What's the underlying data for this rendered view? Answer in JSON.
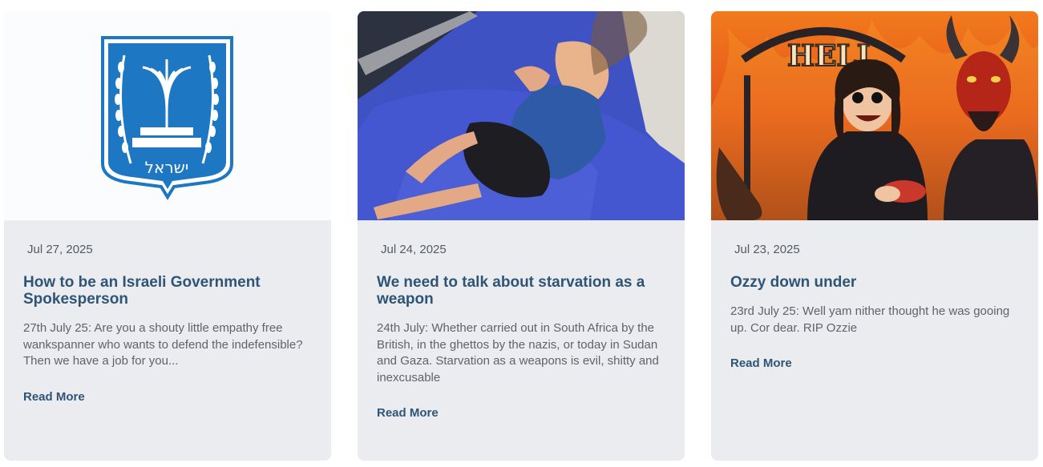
{
  "posts": [
    {
      "image": "israel-emblem-image",
      "date": "Jul 27, 2025",
      "title": "How to be an Israeli Government Spokesperson",
      "excerpt": "27th July 25: Are you a shouty little empathy free wankspanner who wants to defend the indefensible? Then we have a job for you...",
      "read_more": "Read More",
      "emblem_text": "ישראל"
    },
    {
      "image": "starving-child-photo",
      "date": "Jul 24, 2025",
      "title": "We need to talk about starvation as a weapon",
      "excerpt": "24th July: Whether carried out in South Africa by the British, in the ghettos by the nazis, or today in Sudan and Gaza. Starvation as a weapons is evil, shitty and inexcusable",
      "read_more": "Read More"
    },
    {
      "image": "hell-cartoon-image",
      "date": "Jul 23, 2025",
      "title": "Ozzy down under",
      "excerpt": "23rd July 25: Well yam nither thought he was gooing up. Cor dear. RIP Ozzie",
      "read_more": "Read More",
      "sign_text": "HELL"
    }
  ],
  "colors": {
    "card_bg": "#ebecf0",
    "title": "#2f5576",
    "emblem_blue": "#1d77c2"
  }
}
